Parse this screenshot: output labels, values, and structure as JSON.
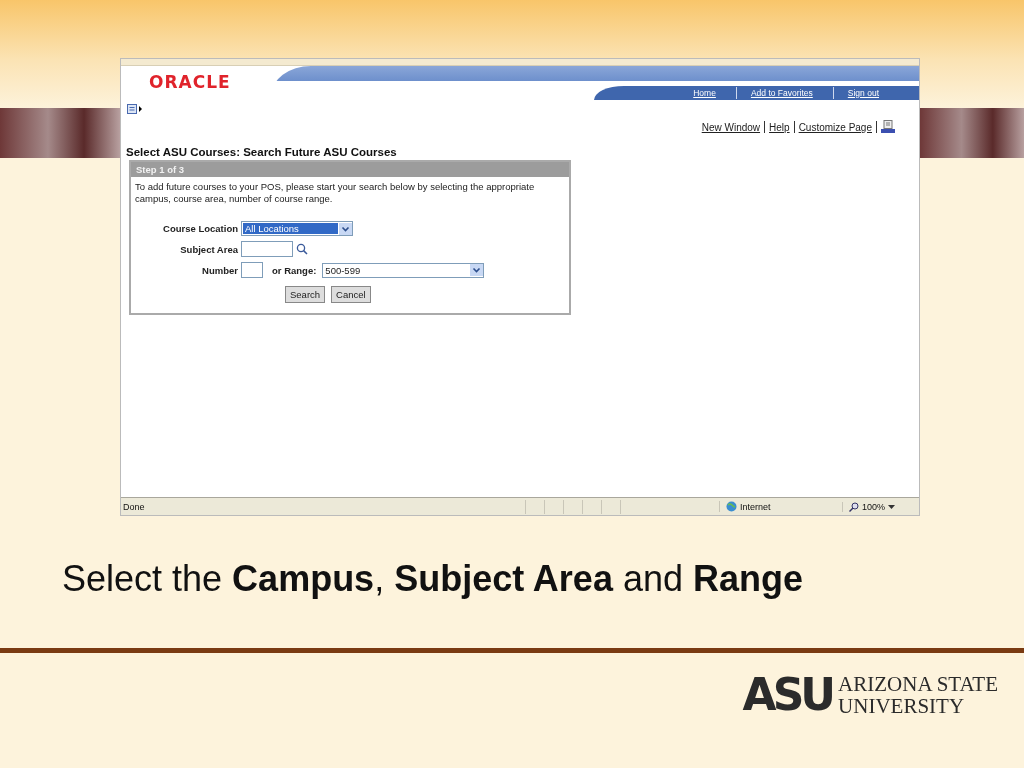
{
  "browser": {
    "header": {
      "logo": "ORACLE",
      "nav_links": [
        "Home",
        "Add to Favorites",
        "Sign out"
      ]
    },
    "page_links": [
      "New Window",
      "Help",
      "Customize Page"
    ],
    "page_title": "Select ASU Courses: Search Future ASU Courses",
    "step": {
      "title": "Step 1 of 3",
      "instructions": "To add future courses to your POS, please start your search below by selecting the appropriate campus, course area, number of course range.",
      "fields": [
        {
          "kind": "select",
          "label": "Course Location",
          "value": "All Locations",
          "selected": true
        },
        {
          "kind": "lookup",
          "label": "Subject Area"
        },
        {
          "kind": "number_range",
          "label": "Number",
          "range_label": "or Range:",
          "range_value": "500-599"
        }
      ],
      "buttons": [
        "Search",
        "Cancel"
      ]
    },
    "status_bar": {
      "status": "Done",
      "zone": "Internet",
      "zoom": "100%"
    }
  },
  "slide": {
    "caption": "Select the **Campus**, **Subject Area** and **Range**",
    "logo": {
      "mark": "ASU",
      "line_1": "ARIZONA STATE",
      "line_2": "UNIVERSITY"
    }
  }
}
